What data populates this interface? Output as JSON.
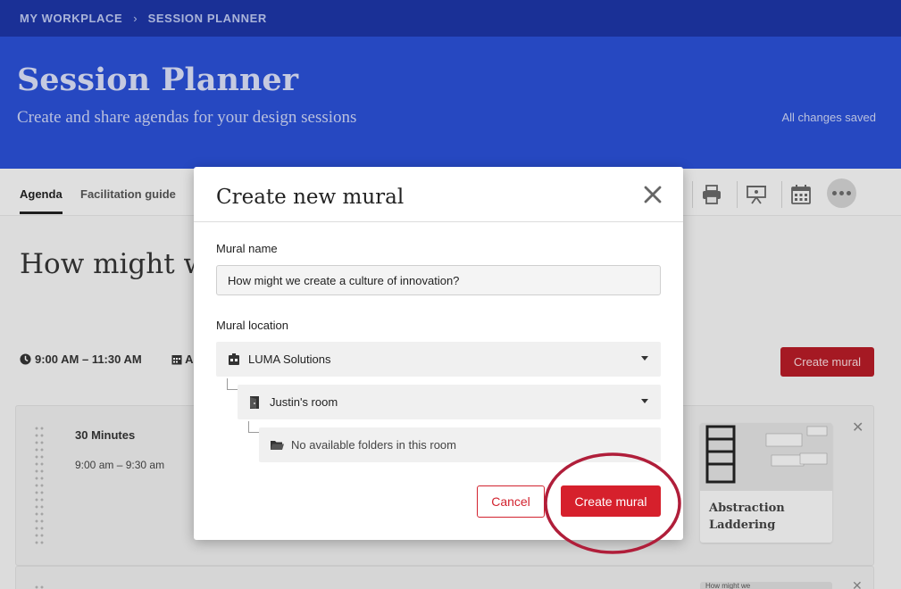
{
  "breadcrumb": {
    "items": [
      "MY WORKPLACE",
      "SESSION PLANNER"
    ]
  },
  "header": {
    "title": "Session Planner",
    "subtitle": "Create and share agendas for your design sessions",
    "status": "All changes saved"
  },
  "tabs": [
    {
      "label": "Agenda",
      "active": true
    },
    {
      "label": "Facilitation guide",
      "active": false
    }
  ],
  "toolbar": {
    "icons": [
      "print-icon",
      "present-icon",
      "calendar-icon",
      "more-icon"
    ]
  },
  "session": {
    "heading_visible": "How might we",
    "time": "9:00 AM – 11:30 AM",
    "date_visible": "A",
    "create_mural_label": "Create mural"
  },
  "agenda_item": {
    "duration": "30 Minutes",
    "time_range": "9:00 am – 9:30 am",
    "method": {
      "name": "Abstraction Laddering"
    },
    "next_method_partial": "How might we"
  },
  "modal": {
    "title": "Create new mural",
    "name_label": "Mural name",
    "name_value": "How might we create a culture of innovation?",
    "location_label": "Mural location",
    "workspace": "LUMA Solutions",
    "room": "Justin's room",
    "folder_message": "No available folders in this room",
    "cancel_label": "Cancel",
    "create_label": "Create mural"
  },
  "colors": {
    "topbar": "#1d35a3",
    "hero": "#2a4fd2",
    "accent_red": "#d6202c",
    "highlight_ring": "#b01e3a"
  }
}
